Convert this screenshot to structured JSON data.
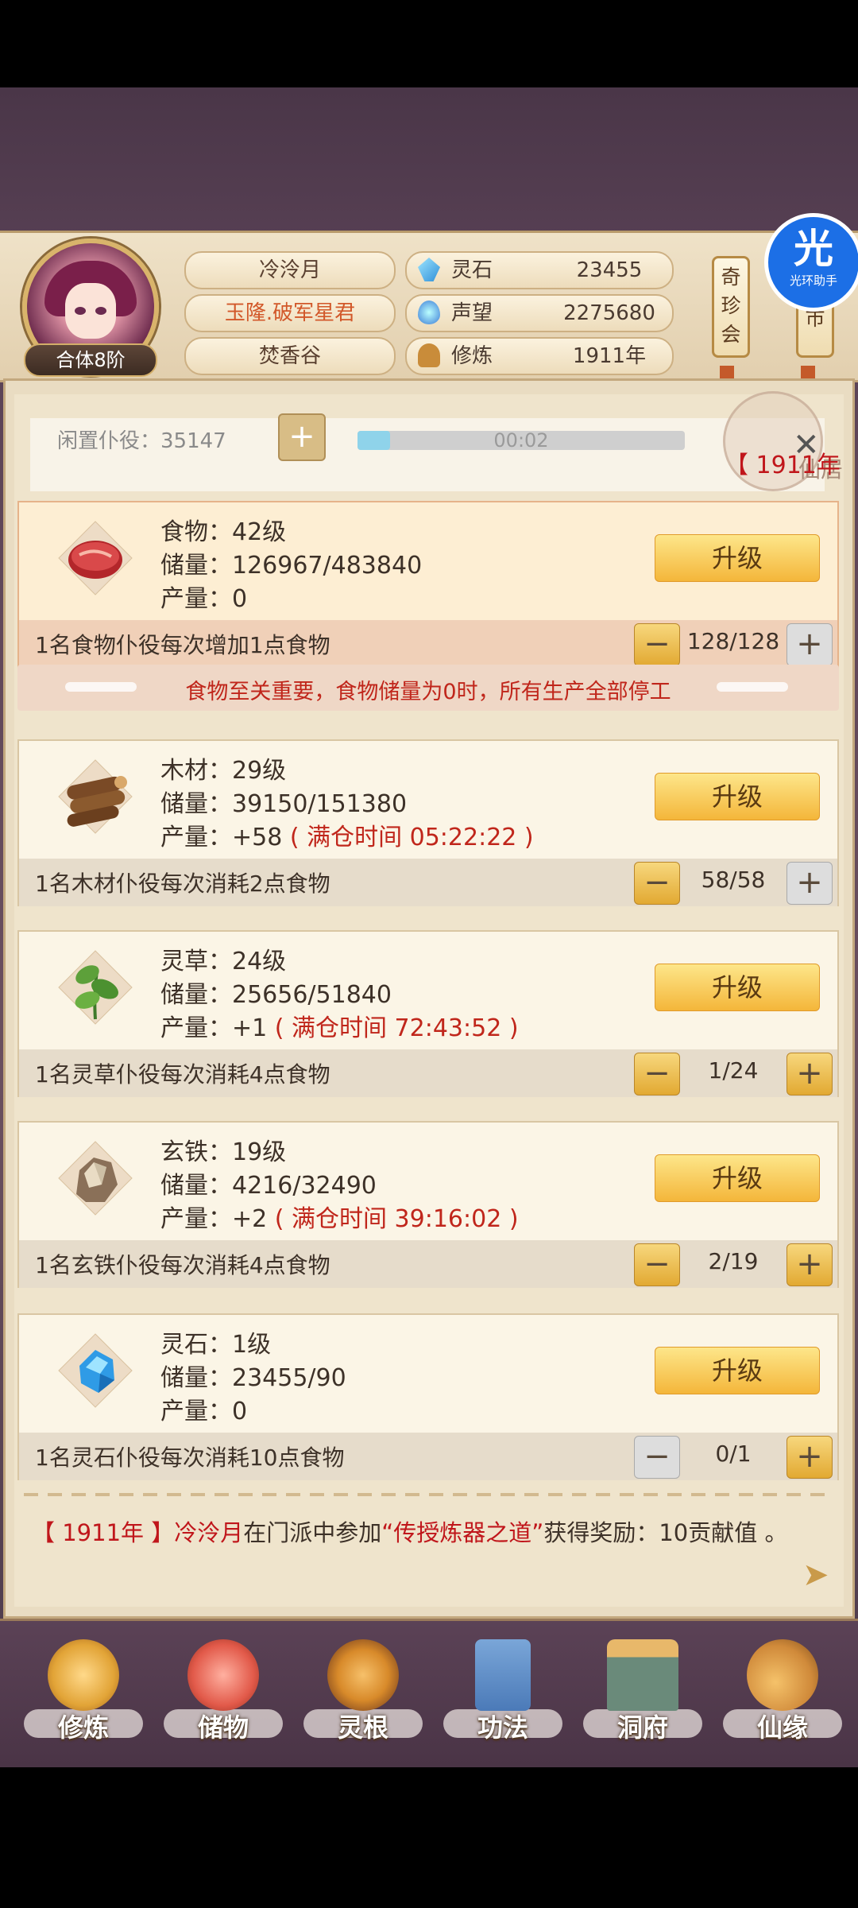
{
  "header": {
    "rank": "合体8阶",
    "name": "冷泠月",
    "title": "玉隆.破军星君",
    "sect": "焚香谷",
    "stats": [
      {
        "label": "灵石",
        "value": "23455",
        "icon": "spirit-stone-icon"
      },
      {
        "label": "声望",
        "value": "2275680",
        "icon": "prestige-icon"
      },
      {
        "label": "修炼",
        "value": "1911年",
        "icon": "cultivation-icon"
      }
    ],
    "scrolls": [
      "奇珍会",
      "市"
    ],
    "badge_big": "光",
    "badge_small": "光环助手"
  },
  "idle": {
    "label": "闲置仆役：35147",
    "plus": "+",
    "timer": "00:02",
    "progress": 0.1,
    "marker_label": "仙居",
    "year_marker": "【 1911年"
  },
  "resources": [
    {
      "name": "food",
      "level": "食物：42级",
      "storage": "储量：126967/483840",
      "output": "产量：0",
      "full_time": "",
      "upgrade": "升级",
      "desc": "1名食物仆役每次增加1点食物",
      "count": "128/128",
      "minus_active": true,
      "plus_active": false
    },
    {
      "name": "wood",
      "level": "木材：29级",
      "storage": "储量：39150/151380",
      "output": "产量：+58",
      "full_time": "( 满仓时间 05:22:22 )",
      "upgrade": "升级",
      "desc": "1名木材仆役每次消耗2点食物",
      "count": "58/58",
      "minus_active": true,
      "plus_active": false
    },
    {
      "name": "herb",
      "level": "灵草：24级",
      "storage": "储量：25656/51840",
      "output": "产量：+1",
      "full_time": "( 满仓时间 72:43:52 )",
      "upgrade": "升级",
      "desc": "1名灵草仆役每次消耗4点食物",
      "count": "1/24",
      "minus_active": true,
      "plus_active": true
    },
    {
      "name": "iron",
      "level": "玄铁：19级",
      "storage": "储量：4216/32490",
      "output": "产量：+2",
      "full_time": "( 满仓时间 39:16:02 )",
      "upgrade": "升级",
      "desc": "1名玄铁仆役每次消耗4点食物",
      "count": "2/19",
      "minus_active": true,
      "plus_active": true
    },
    {
      "name": "stone",
      "level": "灵石：1级",
      "storage": "储量：23455/90",
      "output": "产量：0",
      "full_time": "",
      "upgrade": "升级",
      "desc": "1名灵石仆役每次消耗10点食物",
      "count": "0/1",
      "minus_active": false,
      "plus_active": true
    }
  ],
  "warning": "食物至关重要，食物储量为0时，所有生产全部停工",
  "log": {
    "year": "【 1911年 】",
    "name": "冷泠月",
    "mid": "在门派中参加",
    "quote": "“传授炼器之道”",
    "end": "获得奖励：10贡献值 。"
  },
  "nav": [
    {
      "label": "修炼",
      "icon": "cultivate-icon",
      "color": "#e2a437"
    },
    {
      "label": "储物",
      "icon": "storage-bag-icon",
      "color": "#e25a4a"
    },
    {
      "label": "灵根",
      "icon": "spirit-root-icon",
      "color": "#d88a2a"
    },
    {
      "label": "功法",
      "icon": "technique-book-icon",
      "color": "#4b7ab8"
    },
    {
      "label": "洞府",
      "icon": "cave-mansion-icon",
      "color": "#6a8a7a"
    },
    {
      "label": "仙缘",
      "icon": "immortal-fate-icon",
      "color": "#d08a3a"
    }
  ]
}
